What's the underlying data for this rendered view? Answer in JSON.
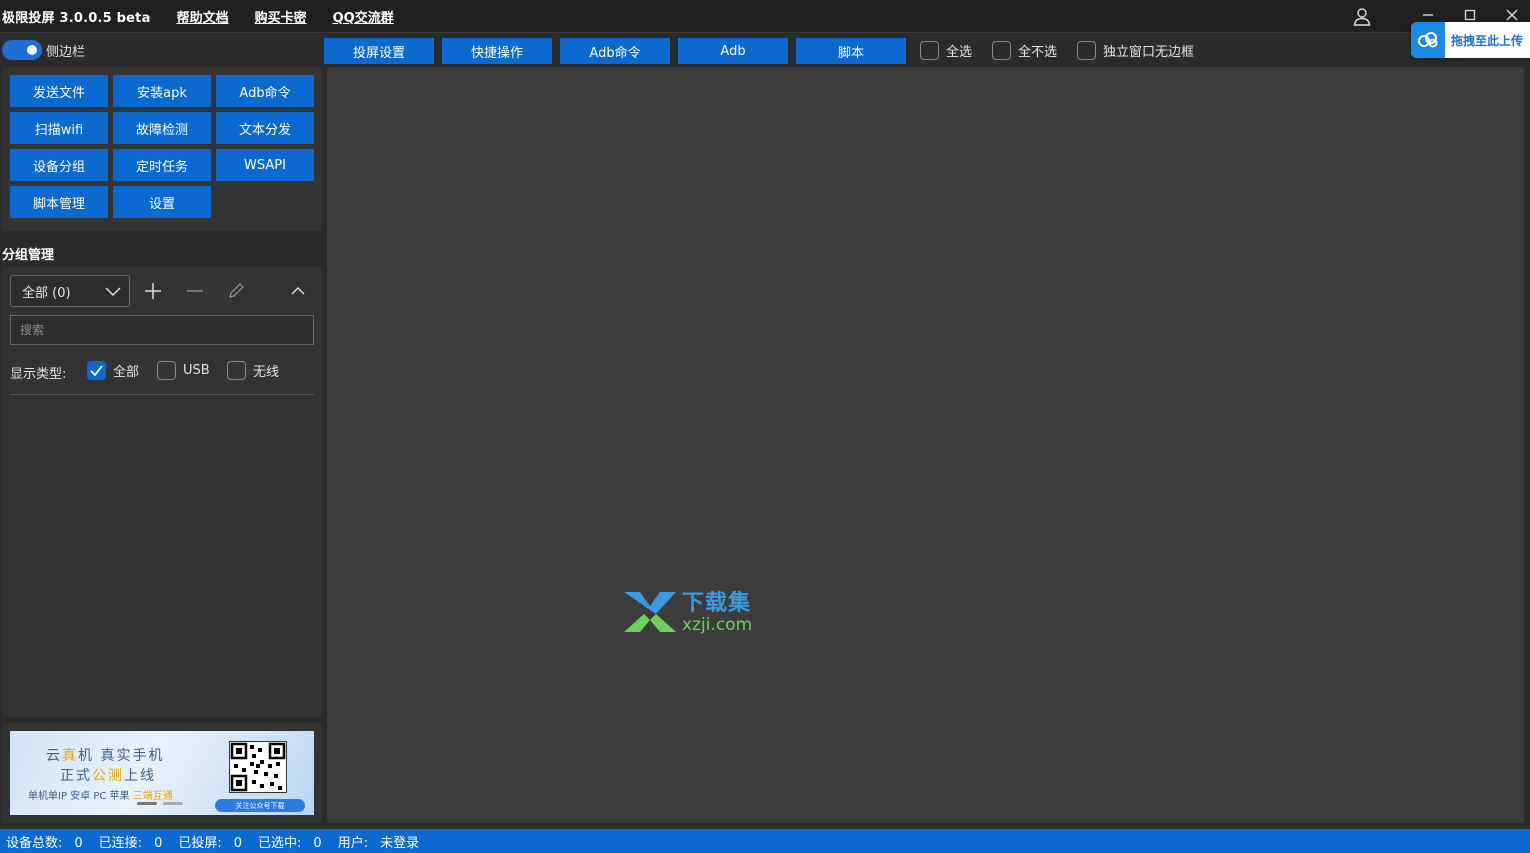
{
  "titlebar": {
    "app_title": "极限投屏 3.0.0.5 beta",
    "links": [
      "帮助文档",
      "购买卡密",
      "QQ交流群"
    ],
    "upload_badge": "拖拽至此上传"
  },
  "toolbar": {
    "sidebar_toggle_label": "侧边栏",
    "sidebar_toggle_on": true,
    "tabs": [
      "投屏设置",
      "快捷操作",
      "Adb命令",
      "Adb",
      "脚本"
    ],
    "checkboxes": [
      {
        "label": "全选",
        "checked": false
      },
      {
        "label": "全不选",
        "checked": false
      },
      {
        "label": "独立窗口无边框",
        "checked": false
      }
    ]
  },
  "tools": {
    "buttons": [
      "发送文件",
      "安装apk",
      "Adb命令",
      "扫描wifi",
      "故障检测",
      "文本分发",
      "设备分组",
      "定时任务",
      "WSAPI",
      "脚本管理",
      "设置"
    ]
  },
  "group": {
    "section_title": "分组管理",
    "selected": "全部 (0)",
    "search_placeholder": "搜索",
    "type_label": "显示类型:",
    "types": [
      {
        "label": "全部",
        "checked": true
      },
      {
        "label": "USB",
        "checked": false
      },
      {
        "label": "无线",
        "checked": false
      }
    ]
  },
  "banner": {
    "line1_a": "云",
    "line1_b": "真",
    "line1_c": "机  真实手机",
    "line2_a": "正式",
    "line2_b": "公测",
    "line2_c": "上线",
    "line3_a": "单机单IP 安卓 PC 苹果 ",
    "line3_b": "三端互通",
    "cta": "关注公众号下载"
  },
  "watermark": {
    "cn": "下载集",
    "en": "xzji.com"
  },
  "statusbar": {
    "items": [
      {
        "label": "设备总数:",
        "value": "0"
      },
      {
        "label": "已连接:",
        "value": "0"
      },
      {
        "label": "已投屏:",
        "value": "0"
      },
      {
        "label": "已选中:",
        "value": "0"
      },
      {
        "label": "用户:",
        "value": "未登录"
      }
    ]
  },
  "colors": {
    "accent": "#0a6ad0",
    "background": "#2b2b2b",
    "panel": "#333333",
    "main_area": "#3c3c3c"
  }
}
